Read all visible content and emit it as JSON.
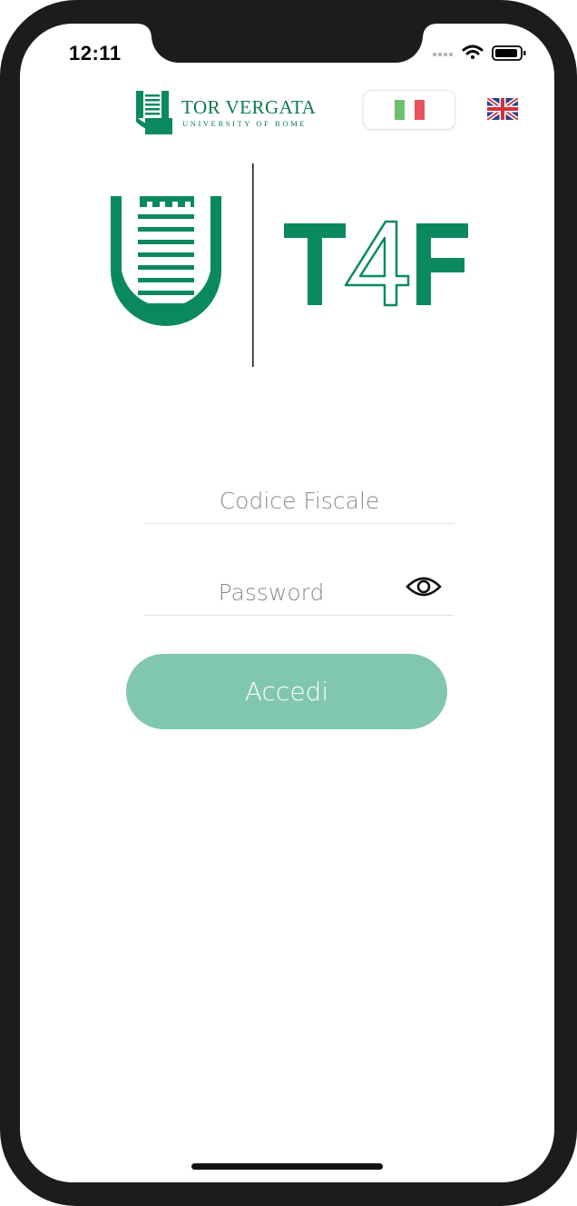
{
  "status_bar": {
    "time": "12:11"
  },
  "header": {
    "university_name": "TOR VERGATA",
    "university_subtitle": "UNIVERSITY OF ROME",
    "lang_it_icon": "italy-flag-icon",
    "lang_en_icon": "uk-flag-icon"
  },
  "app_logo": {
    "text": "T4F"
  },
  "form": {
    "codice_fiscale_placeholder": "Codice Fiscale",
    "password_placeholder": "Password",
    "show_password_icon": "eye-icon",
    "submit_label": "Accedi"
  },
  "colors": {
    "brand_green": "#0a8a5c",
    "button_bg": "#81c6b1",
    "flag_green": "#6fbf6f",
    "flag_red": "#e8545b"
  }
}
